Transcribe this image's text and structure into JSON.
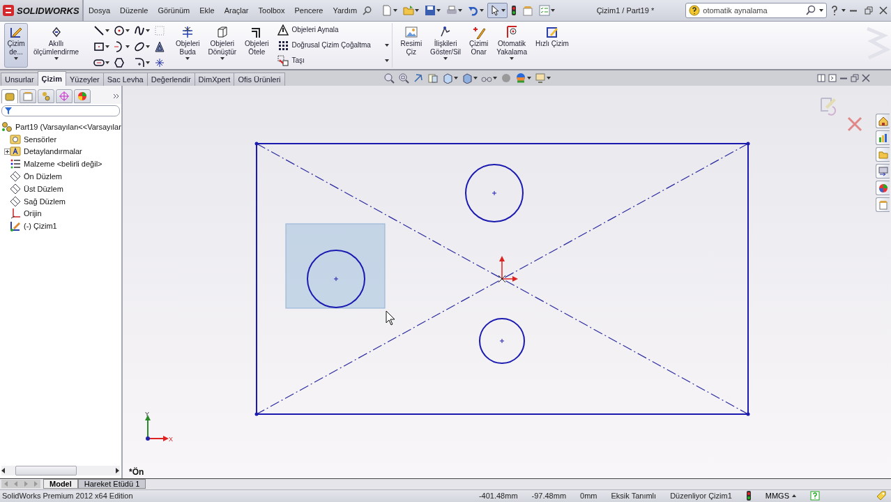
{
  "app": {
    "logo": "SOLIDWORKS"
  },
  "menu": [
    {
      "label": "Dosya"
    },
    {
      "label": "Düzenle"
    },
    {
      "label": "Görünüm"
    },
    {
      "label": "Ekle"
    },
    {
      "label": "Araçlar"
    },
    {
      "label": "Toolbox"
    },
    {
      "label": "Pencere"
    },
    {
      "label": "Yardım"
    }
  ],
  "quick_access": [
    {
      "kind": "new",
      "selected": false
    },
    {
      "kind": "open",
      "selected": false
    },
    {
      "kind": "save",
      "selected": false
    },
    {
      "kind": "print",
      "selected": false
    },
    {
      "kind": "undo",
      "selected": false
    },
    {
      "kind": "select",
      "selected": true
    },
    {
      "kind": "rebuild",
      "selected": false
    },
    {
      "kind": "options",
      "selected": false
    },
    {
      "kind": "list",
      "selected": false
    }
  ],
  "document_title": "Çizim1 / Part19 *",
  "search": {
    "value": "otomatik aynalama"
  },
  "ribbon": [
    {
      "kind": "large",
      "label": "Çizim\nde...",
      "selected": true,
      "dropdown": true
    },
    {
      "kind": "large",
      "label": "Akıllı\nölçümlendirme",
      "selected": false,
      "dropdown": true
    },
    {
      "kind": "tools"
    },
    {
      "kind": "large",
      "label": "Objeleri\nBuda",
      "selected": false,
      "dropdown": true
    },
    {
      "kind": "large",
      "label": "Objeleri\nDönüştür",
      "selected": false,
      "dropdown": true
    },
    {
      "kind": "large",
      "label": "Objeleri\nÖtele",
      "selected": false,
      "dropdown": false
    },
    {
      "kind": "stack",
      "rows": [
        {
          "label": "Objeleri Aynala",
          "dropdown": false
        },
        {
          "label": "Doğrusal Çizim Çoğaltma",
          "dropdown": true
        },
        {
          "label": "Taşı",
          "dropdown": true
        }
      ]
    },
    {
      "kind": "large",
      "label": "Resimi\nÇiz",
      "selected": false,
      "dropdown": false
    },
    {
      "kind": "large",
      "label": "İlişkileri\nGöster/Sil",
      "selected": false,
      "dropdown": true
    },
    {
      "kind": "large",
      "label": "Çizimi\nOnar",
      "selected": false,
      "dropdown": false
    },
    {
      "kind": "large",
      "label": "Otomatik\nYakalama",
      "selected": false,
      "dropdown": true
    },
    {
      "kind": "large",
      "label": "Hızlı Çizim",
      "selected": false,
      "dropdown": false
    }
  ],
  "tabs": [
    {
      "label": "Unsurlar",
      "selected": false
    },
    {
      "label": "Çizim",
      "selected": true
    },
    {
      "label": "Yüzeyler",
      "selected": false
    },
    {
      "label": "Sac Levha",
      "selected": false
    },
    {
      "label": "Değerlendir",
      "selected": false
    },
    {
      "label": "DimXpert",
      "selected": false
    },
    {
      "label": "Ofis Ürünleri",
      "selected": false
    }
  ],
  "panel_tabs": [
    {
      "selected": true
    },
    {
      "selected": false
    },
    {
      "selected": false
    },
    {
      "selected": false
    },
    {
      "selected": false
    }
  ],
  "tree": {
    "label": "Part19  (Varsayılan<<Varsayılar",
    "children": [
      {
        "kind": "sensors",
        "label": "Sensörler"
      },
      {
        "kind": "annotations",
        "label": "Detaylandırmalar",
        "expanded": false
      },
      {
        "kind": "material",
        "label": "Malzeme <belirli değil>"
      },
      {
        "kind": "plane",
        "label": "Ön Düzlem"
      },
      {
        "kind": "plane",
        "label": "Üst Düzlem"
      },
      {
        "kind": "plane",
        "label": "Sağ Düzlem"
      },
      {
        "kind": "origin",
        "label": "Orijin"
      },
      {
        "kind": "sketch",
        "label": "(-) Çizim1"
      }
    ]
  },
  "viewport": {
    "view_name": "*Ön",
    "axis_x": "X",
    "axis_y": "Y"
  },
  "bottom_tabs": [
    {
      "label": "Model",
      "selected": true
    },
    {
      "label": "Hareket Etüdü 1",
      "selected": false
    }
  ],
  "status_bar": {
    "edition": "SolidWorks Premium 2012 x64 Edition",
    "x": "-401.48mm",
    "y": "-97.48mm",
    "z": "0mm",
    "state": "Eksik Tanımlı",
    "editing": "Düzenliyor Çizim1",
    "units": "MMGS"
  }
}
